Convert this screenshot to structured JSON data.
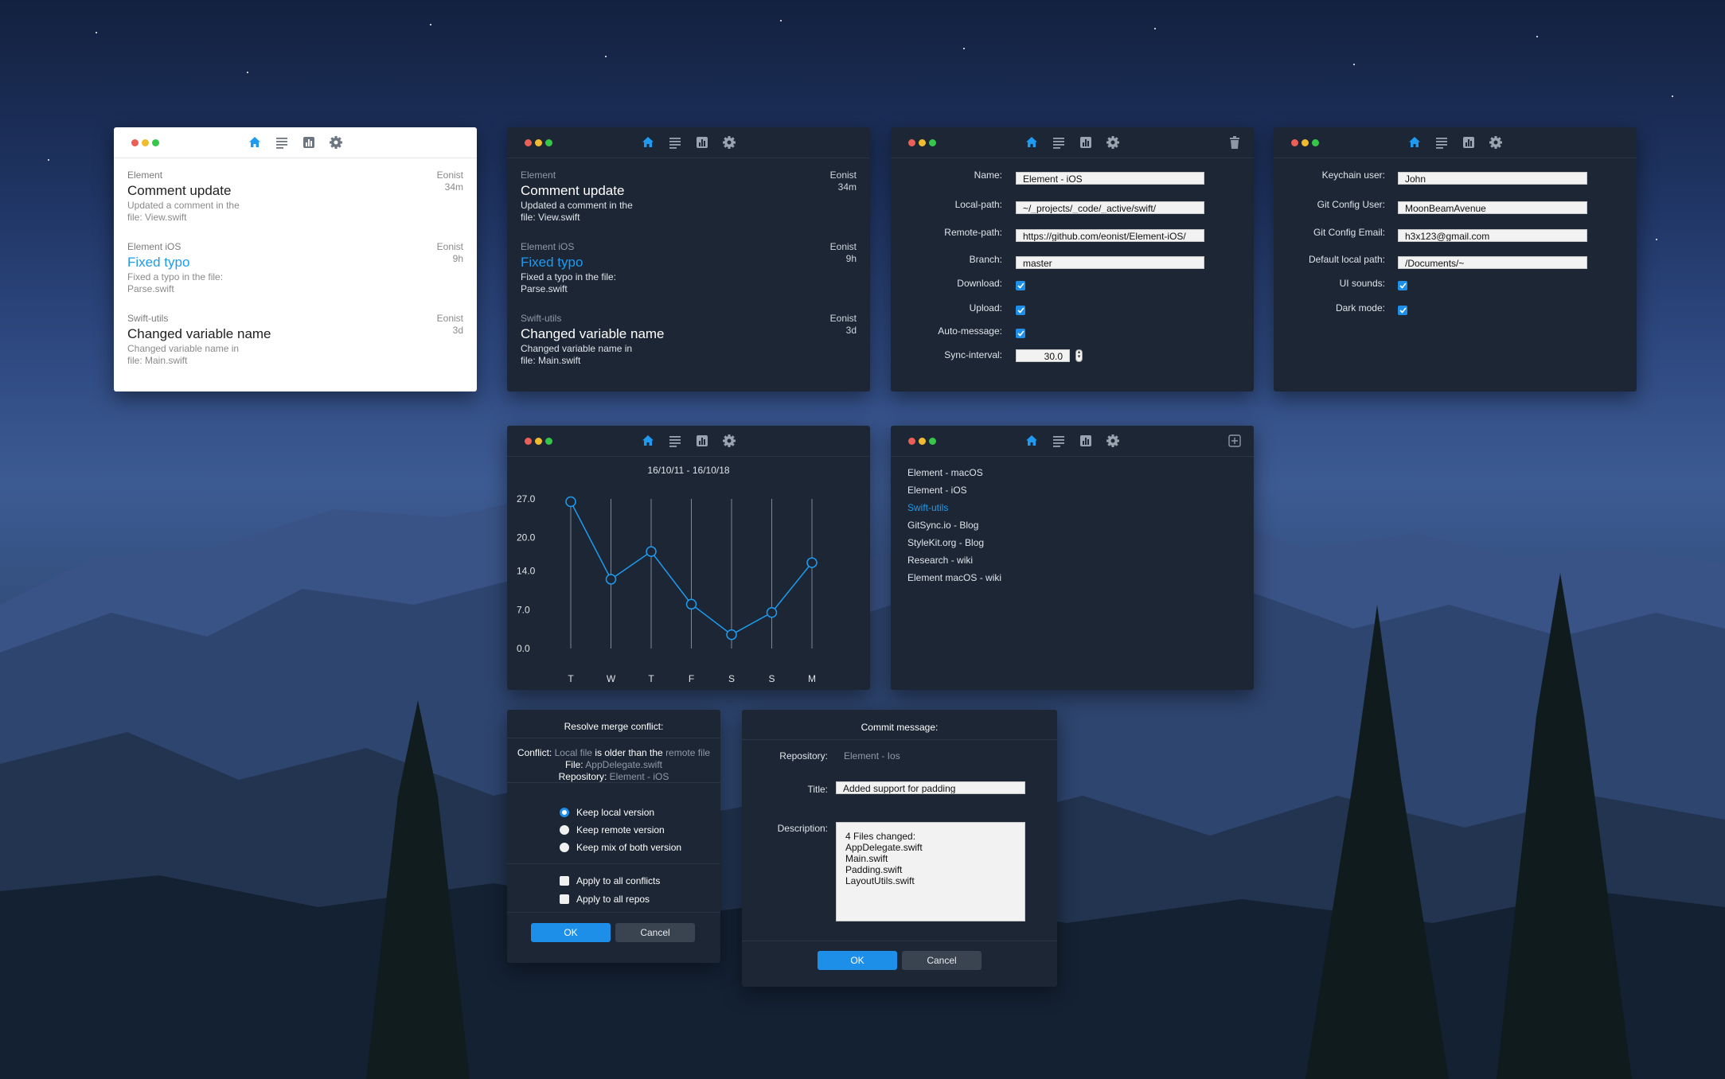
{
  "nav_icons": [
    "home-icon",
    "list-icon",
    "chart-icon",
    "gear-icon"
  ],
  "colors": {
    "accent": "#1e9bf0",
    "panel_dark": "#1c2634",
    "panel_light": "#ffffff",
    "ok_button": "#1e8fe8"
  },
  "commits": [
    {
      "repo": "Element",
      "title": "Comment update",
      "desc1": "Updated a comment in the",
      "desc2": "file: View.swift",
      "author": "Eonist",
      "time": "34m"
    },
    {
      "repo": "Element iOS",
      "title": "Fixed typo",
      "desc1": "Fixed a typo in the file:",
      "desc2": "Parse.swift",
      "author": "Eonist",
      "time": "9h"
    },
    {
      "repo": "Swift-utils",
      "title": "Changed variable name",
      "desc1": "Changed variable name in",
      "desc2": "file: Main.swift",
      "author": "Eonist",
      "time": "3d"
    }
  ],
  "repo_detail": {
    "name_label": "Name:",
    "name_value": "Element - iOS",
    "local_path_label": "Local-path:",
    "local_path_value": "~/_projects/_code/_active/swift/",
    "remote_path_label": "Remote-path:",
    "remote_path_value": "https://github.com/eonist/Element-iOS/",
    "branch_label": "Branch:",
    "branch_value": "master",
    "download_label": "Download:",
    "download_checked": true,
    "upload_label": "Upload:",
    "upload_checked": true,
    "auto_message_label": "Auto-message:",
    "auto_message_checked": true,
    "sync_interval_label": "Sync-interval:",
    "sync_interval_value": "30.0",
    "delete_icon": "trash-icon"
  },
  "prefs": {
    "keychain_label": "Keychain user:",
    "keychain_value": "John",
    "git_user_label": "Git Config User:",
    "git_user_value": "MoonBeamAvenue",
    "git_email_label": "Git Config Email:",
    "git_email_value": "h3x123@gmail.com",
    "local_path_label": "Default local path:",
    "local_path_value": "/Documents/~",
    "ui_sounds_label": "UI sounds:",
    "ui_sounds_checked": true,
    "dark_mode_label": "Dark mode:",
    "dark_mode_checked": true
  },
  "stats": {
    "date_range": "16/10/11 - 16/10/18"
  },
  "chart_data": {
    "type": "line",
    "title": "16/10/11 - 16/10/18",
    "categories": [
      "T",
      "W",
      "T",
      "F",
      "S",
      "S",
      "M"
    ],
    "series": [
      {
        "values": [
          26.5,
          12.5,
          17.5,
          8.0,
          2.5,
          6.5,
          15.5
        ]
      }
    ],
    "y_ticks": [
      "27.0",
      "20.0",
      "14.0",
      "7.0",
      "0.0"
    ],
    "ylim": [
      0,
      27
    ],
    "xlabel": "",
    "ylabel": "",
    "grid": "vertical lines only"
  },
  "repo_list": {
    "items": [
      "Element - macOS",
      "Element - iOS",
      "Swift-utils",
      "GitSync.io - Blog",
      "StyleKit.org - Blog",
      "Research - wiki",
      "Element macOS - wiki"
    ],
    "selected_index": 2,
    "add_icon": "add-icon"
  },
  "merge_dialog": {
    "title": "Resolve merge conflict:",
    "conflict_label": "Conflict:",
    "local_file": "Local file",
    "conflict_mid": "is older than the",
    "remote_file": "remote file",
    "file_label": "File:",
    "file_value": "AppDelegate.swift",
    "repository_label": "Repository:",
    "repository_value": "Element - iOS",
    "options": [
      "Keep local version",
      "Keep remote version",
      "Keep mix of both version"
    ],
    "selected_option": 0,
    "apply_conflicts": "Apply to all conflicts",
    "apply_repos": "Apply to all repos",
    "ok": "OK",
    "cancel": "Cancel"
  },
  "commit_dialog": {
    "title": "Commit message:",
    "repository_label": "Repository:",
    "repository_value": "Element - Ios",
    "title_label": "Title:",
    "title_value": "Added support for padding",
    "description_label": "Description:",
    "description_lines": [
      "4 Files changed:",
      "AppDelegate.swift",
      "Main.swift",
      "Padding.swift",
      "LayoutUtils.swift"
    ],
    "ok": "OK",
    "cancel": "Cancel"
  }
}
